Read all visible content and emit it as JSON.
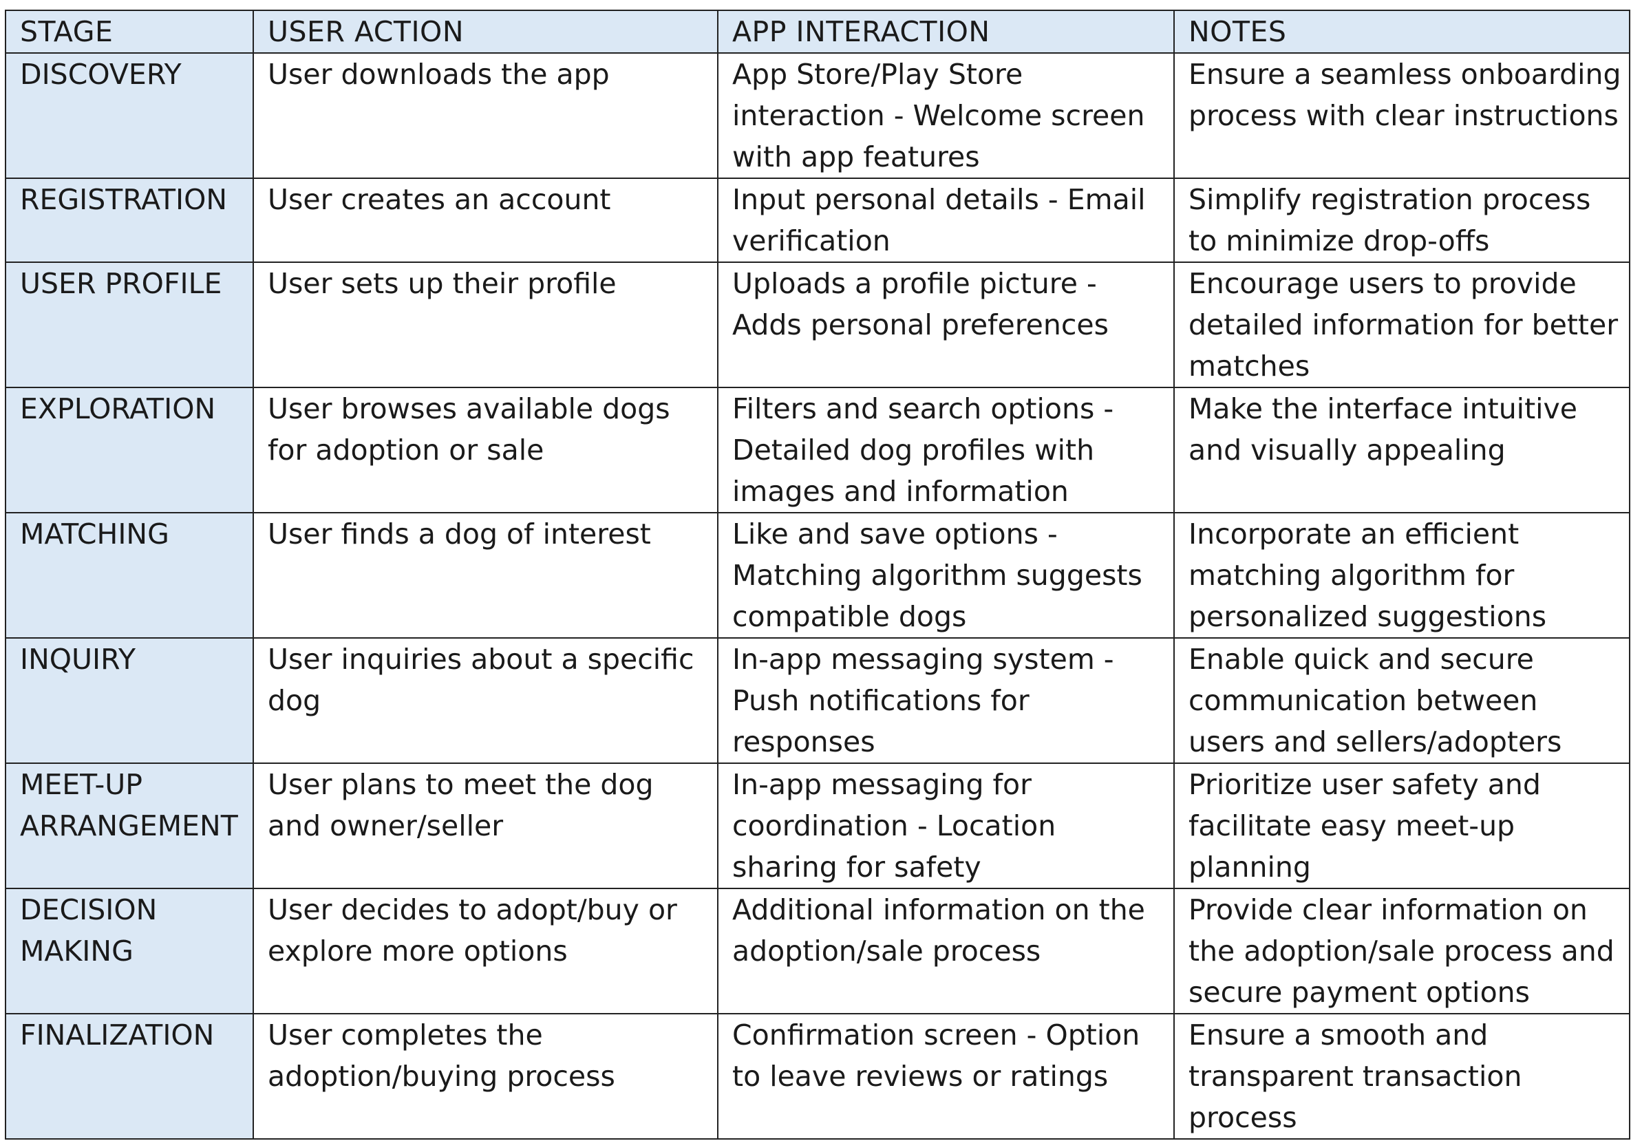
{
  "headers": {
    "stage": "STAGE",
    "user_action": "USER ACTION",
    "app_interaction": "APP INTERACTION",
    "notes": "NOTES"
  },
  "rows": [
    {
      "stage": "DISCOVERY",
      "user_action": "User downloads the app",
      "app_interaction": "App Store/Play Store interaction - Welcome screen with app features",
      "notes": "Ensure a seamless onboarding process with clear instructions"
    },
    {
      "stage": "REGISTRATION",
      "user_action": "User creates an account",
      "app_interaction": "Input personal details - Email verification",
      "notes": "Simplify registration process to minimize drop-offs"
    },
    {
      "stage": "USER PROFILE",
      "user_action": "User sets up their profile",
      "app_interaction": "Uploads a profile picture - Adds personal preferences",
      "notes": "Encourage users to provide detailed information for better matches"
    },
    {
      "stage": "EXPLORATION",
      "user_action": "User browses available dogs for adoption or sale",
      "app_interaction": "Filters and search options - Detailed dog profiles with images and information",
      "notes": "Make the interface intuitive and visually appealing"
    },
    {
      "stage": "MATCHING",
      "user_action": "User finds a dog of interest",
      "app_interaction": "Like and save options - Matching algorithm suggests compatible dogs",
      "notes": "Incorporate an efficient matching algorithm for personalized suggestions"
    },
    {
      "stage": "INQUIRY",
      "user_action": "User inquiries about a specific dog",
      "app_interaction": "In-app messaging system - Push notifications for responses",
      "notes": "Enable quick and secure communication between users and sellers/adopters"
    },
    {
      "stage": "MEET-UP ARRANGEMENT",
      "user_action": "User plans to meet the dog and owner/seller",
      "app_interaction": "In-app messaging for coordination - Location sharing for safety",
      "notes": "Prioritize user safety and facilitate easy meet-up planning"
    },
    {
      "stage": "DECISION MAKING",
      "user_action": "User decides to adopt/buy or explore more options",
      "app_interaction": "Additional information on the adoption/sale process",
      "notes": "Provide clear information on the adoption/sale process and secure payment options"
    },
    {
      "stage": "FINALIZATION",
      "user_action": "User completes the adoption/buying process",
      "app_interaction": "Confirmation screen - Option to leave reviews or ratings",
      "notes": "Ensure a smooth and transparent transaction process"
    }
  ],
  "colors": {
    "header_bg": "#dbe8f5",
    "stage_bg": "#dbe8f5",
    "border": "#222222",
    "text": "#1a1a1a"
  }
}
